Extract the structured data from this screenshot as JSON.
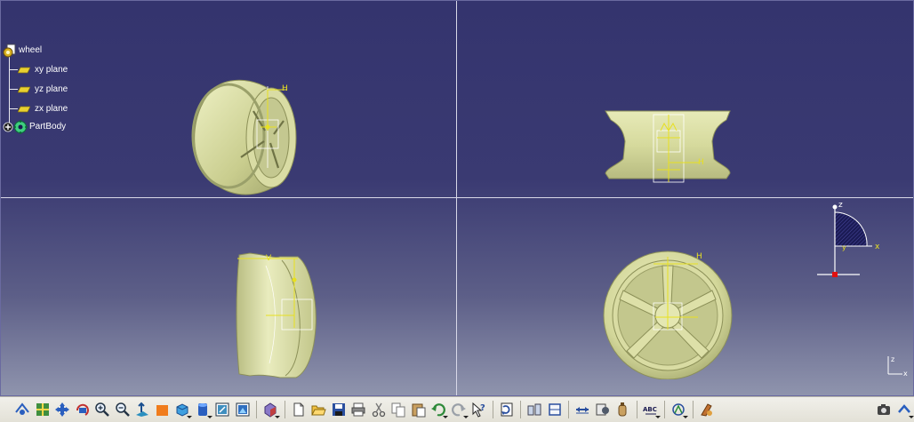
{
  "tree": {
    "root": "wheel",
    "items": [
      {
        "label": "xy plane",
        "icon": "plane-icon"
      },
      {
        "label": "yz plane",
        "icon": "plane-icon"
      },
      {
        "label": "zx plane",
        "icon": "plane-icon"
      },
      {
        "label": "PartBody",
        "icon": "partbody-gear-icon"
      }
    ]
  },
  "viewports": {
    "isometric": {
      "sketch_label": "H"
    },
    "front": {
      "sketch_label": "H"
    },
    "side": {
      "sketch_label": "V"
    },
    "top": {
      "sketch_label": "H"
    }
  },
  "compass": {
    "z_label": "z",
    "x_label": "x",
    "y_label": "y"
  },
  "mini_axis": {
    "z_label": "z",
    "x_label": "x"
  },
  "toolbar": {
    "items": [
      "fly-mode-icon",
      "fit-all-icon",
      "pan-icon",
      "rotate-icon",
      "zoom-in-icon",
      "zoom-out-icon",
      "normal-view-icon",
      "iso-view-icon",
      "render-style-icon",
      "hide-show-icon",
      "swap-visible-icon",
      "apply-material-icon",
      "new-icon",
      "open-icon",
      "save-icon",
      "print-icon",
      "cut-icon",
      "copy-icon",
      "paste-icon",
      "undo-icon",
      "redo-icon",
      "whats-this-icon",
      "update-icon",
      "measure-between-icon",
      "measure-item-icon",
      "measure-inertia-icon",
      "knowledge-icon",
      "parameters-icon",
      "text-annotation-icon",
      "3d-compass-icon",
      "material-icon",
      "camera-icon",
      "more-icon"
    ],
    "text_labels": {
      "abc": "ABC"
    }
  },
  "colors": {
    "background_top": "#34346e",
    "background_bottom": "#8f94ad",
    "wheel": "#d7dba0",
    "sketch": "#e8e020",
    "toolbar": "#e8e6dc"
  }
}
